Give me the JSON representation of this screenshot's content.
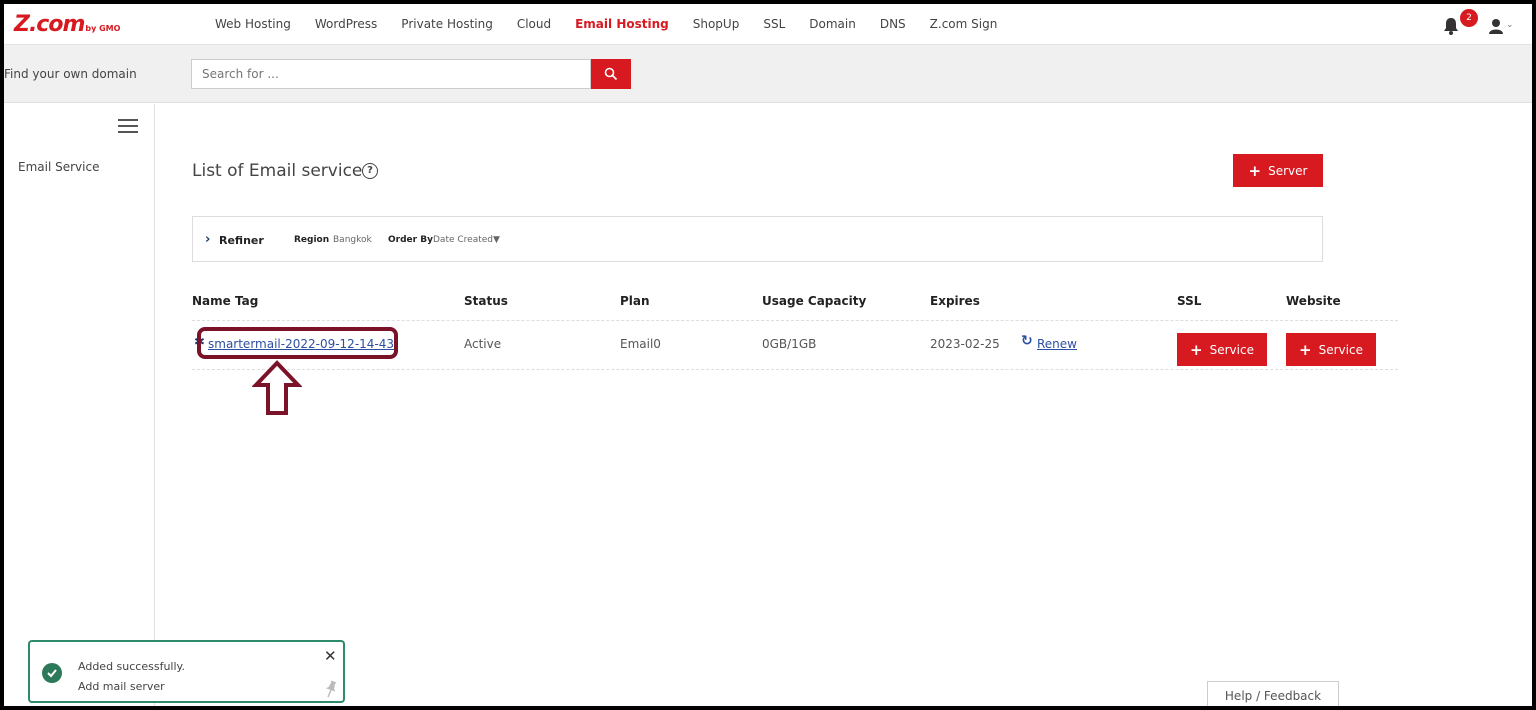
{
  "header": {
    "logo": "Z.com",
    "logo_suffix": "by GMO",
    "nav": [
      {
        "label": "Web Hosting",
        "active": false
      },
      {
        "label": "WordPress",
        "active": false
      },
      {
        "label": "Private Hosting",
        "active": false
      },
      {
        "label": "Cloud",
        "active": false
      },
      {
        "label": "Email Hosting",
        "active": true
      },
      {
        "label": "ShopUp",
        "active": false
      },
      {
        "label": "SSL",
        "active": false
      },
      {
        "label": "Domain",
        "active": false
      },
      {
        "label": "DNS",
        "active": false
      },
      {
        "label": "Z.com Sign",
        "active": false
      }
    ],
    "notification_count": "2",
    "accent_color": "#d71920"
  },
  "search": {
    "label": "Find your own domain",
    "placeholder": "Search for ..."
  },
  "sidebar": {
    "items": [
      {
        "label": "Email Service"
      }
    ]
  },
  "main": {
    "title": "List of Email service",
    "help_glyph": "?",
    "server_button": "Server",
    "refiner": {
      "label": "Refiner",
      "region_key": "Region",
      "region_value": "Bangkok",
      "order_key": "Order By",
      "order_value": "Date Created▼"
    },
    "table": {
      "columns": [
        "Name Tag",
        "Status",
        "Plan",
        "Usage Capacity",
        "Expires",
        "SSL",
        "Website"
      ],
      "rows": [
        {
          "name_tag": "smartermail-2022-09-12-14-43",
          "status": "Active",
          "plan": "Email0",
          "usage": "0GB/1GB",
          "expires": "2023-02-25",
          "renew": "Renew",
          "ssl_button": "Service",
          "website_button": "Service"
        }
      ]
    }
  },
  "toast": {
    "title": "Added successfully.",
    "message": "Add mail server",
    "border_color": "#2d8a6a"
  },
  "footer": {
    "help_feedback": "Help / Feedback"
  }
}
